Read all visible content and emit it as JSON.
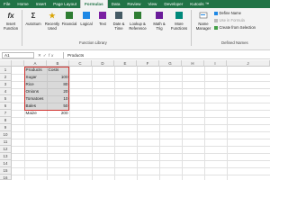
{
  "ribbon_tabs": [
    "File",
    "Home",
    "Insert",
    "Page Layout",
    "Formulas",
    "Data",
    "Review",
    "View",
    "Developer",
    "Kutools ™"
  ],
  "active_tab": "Formulas",
  "ribbon": {
    "insert_function": "Insert Function",
    "autosum": "AutoSum",
    "recently_used": "Recently Used",
    "financial": "Financial",
    "logical": "Logical",
    "text": "Text",
    "date_time": "Date & Time",
    "lookup_reference": "Lookup & Reference",
    "math_trig": "Math & Trig",
    "more_functions": "More Functions",
    "function_library": "Function Library",
    "name_manager": "Name Manager",
    "define_name": "Define Name",
    "use_in_formula": "Use in Formula",
    "create_from_selection": "Create from Selection",
    "defined_names": "Defined Names"
  },
  "formula_bar": {
    "name_box": "A1",
    "fx": "fx",
    "content": "Products"
  },
  "columns": [
    "A",
    "B",
    "C",
    "D",
    "E",
    "F",
    "G",
    "H",
    "I",
    "J"
  ],
  "rows": [
    "1",
    "2",
    "3",
    "4",
    "5",
    "6",
    "7",
    "8",
    "9",
    "10",
    "11",
    "12",
    "13",
    "14",
    "15",
    "16"
  ],
  "table": {
    "headers": [
      "Products",
      "Costs"
    ],
    "rows": [
      [
        "Sugar",
        "100"
      ],
      [
        "Rice",
        "80"
      ],
      [
        "Onions",
        "20"
      ],
      [
        "Tomatoes",
        "10"
      ],
      [
        "Bales",
        "50"
      ],
      [
        "Maize",
        "200"
      ]
    ]
  },
  "colors": {
    "brand": "#217346",
    "selection_border": "#d0312d"
  }
}
